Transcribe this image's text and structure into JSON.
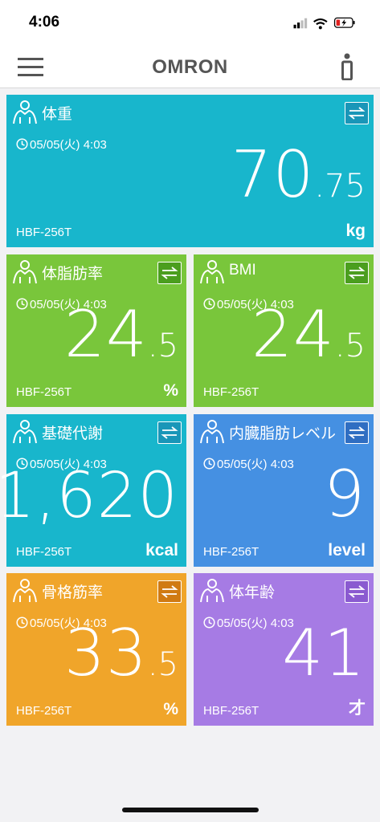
{
  "status": {
    "time": "4:06"
  },
  "nav": {
    "brand": "OMRON"
  },
  "cards": [
    {
      "title": "体重",
      "time": "05/05(火) 4:03",
      "device": "HBF-256T",
      "value_int": "70",
      "value_dec": ".75",
      "unit": "kg",
      "color": "#18b6cc",
      "btn": "#1996b8"
    },
    {
      "title": "体脂肪率",
      "time": "05/05(火) 4:03",
      "device": "HBF-256T",
      "value_int": "24",
      "value_dec": ".5",
      "unit": "%",
      "color": "#79c63b",
      "btn": "#4b9e1e"
    },
    {
      "title": "BMI",
      "time": "05/05(火) 4:03",
      "device": "HBF-256T",
      "value_int": "24",
      "value_dec": ".5",
      "unit": "",
      "color": "#79c63b",
      "btn": "#4b9e1e"
    },
    {
      "title": "基礎代謝",
      "time": "05/05(火) 4:03",
      "device": "HBF-256T",
      "value_int": "1,620",
      "value_dec": "",
      "unit": "kcal",
      "color": "#18b6cc",
      "btn": "#1996b8"
    },
    {
      "title": "内臓脂肪レベル",
      "time": "05/05(火) 4:03",
      "device": "HBF-256T",
      "value_int": "9",
      "value_dec": "",
      "unit": "level",
      "color": "#4590e2",
      "btn": "#2f6ec2"
    },
    {
      "title": "骨格筋率",
      "time": "05/05(火) 4:03",
      "device": "HBF-256T",
      "value_int": "33",
      "value_dec": ".5",
      "unit": "%",
      "color": "#f0a52a",
      "btn": "#d07a12"
    },
    {
      "title": "体年齢",
      "time": "05/05(火) 4:03",
      "device": "HBF-256T",
      "value_int": "41",
      "value_dec": "",
      "unit": "才",
      "color": "#a67be4",
      "btn": "#8a5ad0"
    }
  ],
  "colors": {
    "accent_teal": "#18b6cc",
    "accent_green": "#79c63b",
    "accent_blue": "#4590e2",
    "accent_orange": "#f0a52a",
    "accent_purple": "#a67be4"
  }
}
